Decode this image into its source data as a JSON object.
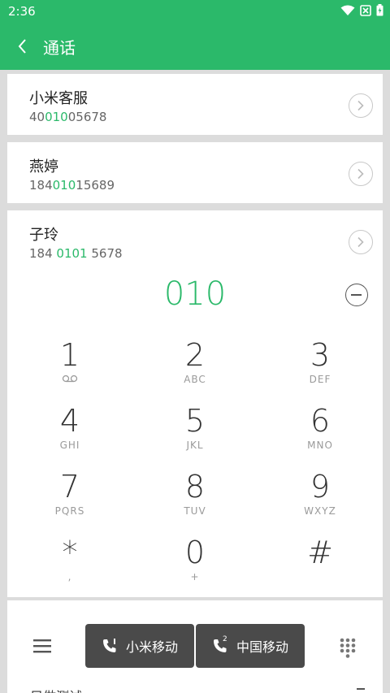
{
  "status_bar": {
    "time": "2:36",
    "icons": [
      "wifi-icon",
      "no-sim-icon",
      "battery-icon"
    ]
  },
  "app_bar": {
    "title": "通话",
    "back_icon": "chevron-left-icon"
  },
  "contacts": [
    {
      "name": "小米客服",
      "number_pre": "40",
      "number_hl": "010",
      "number_post": "05678"
    },
    {
      "name": "燕婷",
      "number_pre": "184",
      "number_hl": "010",
      "number_post": "15689"
    },
    {
      "name": "子玲",
      "number_pre": "184 ",
      "number_hl": "0101",
      "number_post": " 5678"
    }
  ],
  "dialer": {
    "number": "010",
    "keys": [
      {
        "digit": "1",
        "letters": ""
      },
      {
        "digit": "2",
        "letters": "ABC"
      },
      {
        "digit": "3",
        "letters": "DEF"
      },
      {
        "digit": "4",
        "letters": "GHI"
      },
      {
        "digit": "5",
        "letters": "JKL"
      },
      {
        "digit": "6",
        "letters": "MNO"
      },
      {
        "digit": "7",
        "letters": "PQRS"
      },
      {
        "digit": "8",
        "letters": "TUV"
      },
      {
        "digit": "9",
        "letters": "WXYZ"
      },
      {
        "digit": "*",
        "letters": ","
      },
      {
        "digit": "0",
        "letters": "+"
      },
      {
        "digit": "#",
        "letters": ""
      }
    ]
  },
  "bottom": {
    "sim1_label": "小米移动",
    "sim2_label": "中国移动",
    "sim2_index": "2",
    "peek_text": "只做测试"
  },
  "colors": {
    "accent": "#2bb96a",
    "sim_button": "#4a4a4a"
  }
}
